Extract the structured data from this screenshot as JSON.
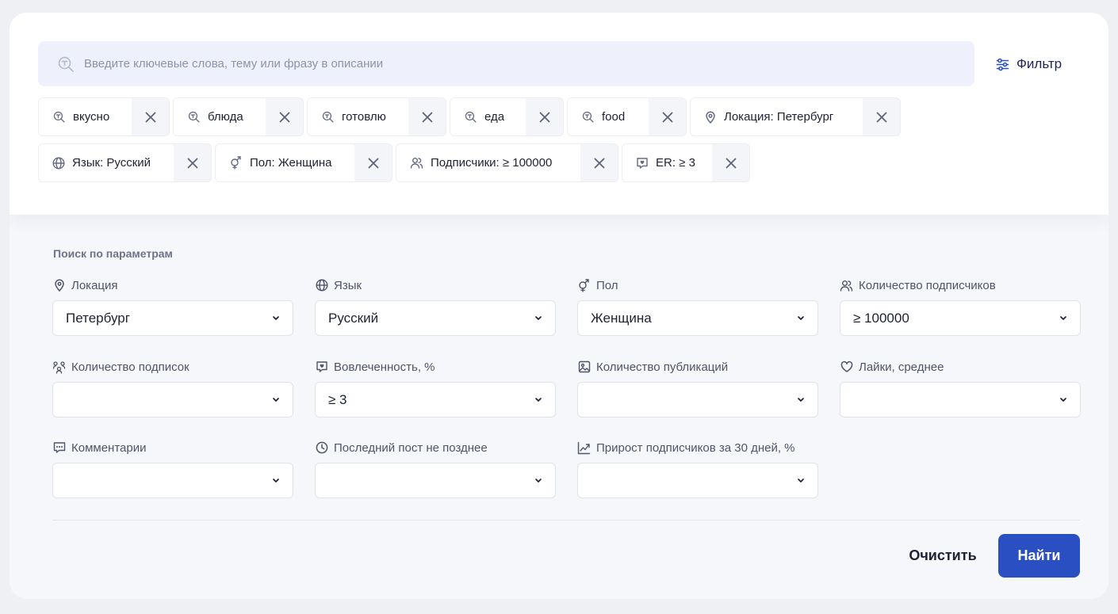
{
  "search": {
    "placeholder": "Введите ключевые слова, тему или фразу в описании",
    "icon": "search-keyword-icon"
  },
  "filter": {
    "label": "Фильтр",
    "icon": "sliders-icon"
  },
  "chips": [
    {
      "label": "вкусно",
      "icon": "search-keyword-icon"
    },
    {
      "label": "блюда",
      "icon": "search-keyword-icon"
    },
    {
      "label": "готовлю",
      "icon": "search-keyword-icon"
    },
    {
      "label": "еда",
      "icon": "search-keyword-icon"
    },
    {
      "label": "food",
      "icon": "search-keyword-icon"
    },
    {
      "label": "Локация: Петербург",
      "icon": "location-pin-icon"
    },
    {
      "label": "Язык: Русский",
      "icon": "globe-icon"
    },
    {
      "label": "Пол: Женщина",
      "icon": "gender-icon"
    },
    {
      "label": "Подписчики: ≥ 100000",
      "icon": "users-icon"
    },
    {
      "label": "ER: ≥ 3",
      "icon": "engagement-icon"
    }
  ],
  "params": {
    "title": "Поиск по параметрам",
    "fields": [
      {
        "label": "Локация",
        "value": "Петербург",
        "icon": "location-pin-icon"
      },
      {
        "label": "Язык",
        "value": "Русский",
        "icon": "globe-icon"
      },
      {
        "label": "Пол",
        "value": "Женщина",
        "icon": "gender-icon"
      },
      {
        "label": "Количество подписчиков",
        "value": "≥ 100000",
        "icon": "users-icon"
      },
      {
        "label": "Количество подписок",
        "value": "",
        "icon": "following-icon"
      },
      {
        "label": "Вовлеченность, %",
        "value": "≥ 3",
        "icon": "engagement-icon"
      },
      {
        "label": "Количество публикаций",
        "value": "",
        "icon": "image-icon"
      },
      {
        "label": "Лайки, среднее",
        "value": "",
        "icon": "heart-icon"
      },
      {
        "label": "Комментарии",
        "value": "",
        "icon": "comment-icon"
      },
      {
        "label": "Последний пост не позднее",
        "value": "",
        "icon": "clock-icon"
      },
      {
        "label": "Прирост подписчиков за 30 дней, %",
        "value": "",
        "icon": "growth-chart-icon"
      }
    ]
  },
  "actions": {
    "clear": "Очистить",
    "find": "Найти"
  },
  "colors": {
    "primary": "#2a4fc2",
    "search_bg": "#eef1fb",
    "page_bg": "#f6f7fb"
  }
}
